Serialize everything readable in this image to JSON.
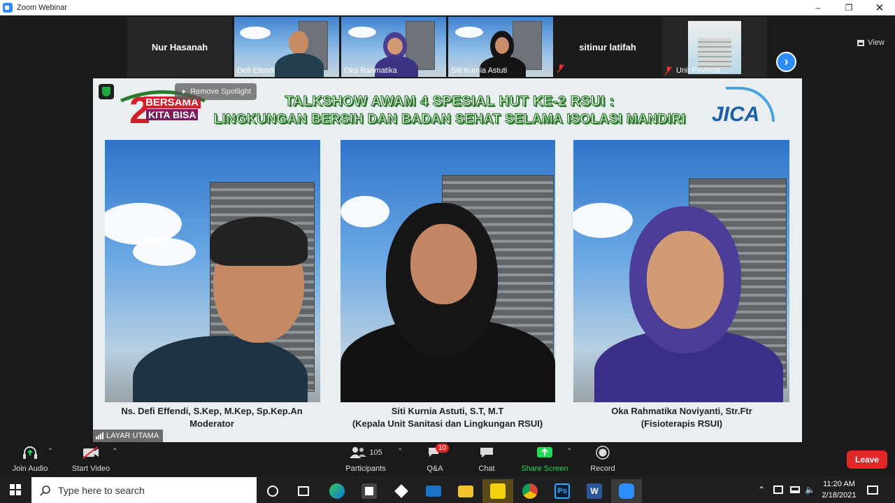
{
  "window": {
    "title": "Zoom Webinar"
  },
  "strip": {
    "tiles": [
      {
        "name": "Nur Hasanah",
        "type": "name-only"
      },
      {
        "name": "Defi Efendi",
        "type": "video"
      },
      {
        "name": "Oka Rahmatika",
        "type": "video"
      },
      {
        "name": "Siti Kurnia Astuti",
        "type": "video"
      },
      {
        "name": "sitinur latifah",
        "type": "name-only"
      },
      {
        "name": "Unit Promosi...",
        "type": "image"
      }
    ],
    "view_label": "View"
  },
  "stage": {
    "spotlight_label": "Remove Spotlight",
    "banner_line1": "TALKSHOW AWAM 4 SPESIAL HUT KE-2 RSUI :",
    "banner_line2": "LINGKUNGAN BERSIH DAN BADAN SEHAT SELAMA ISOLASI MANDIRI",
    "logo_left_lines": [
      "BERSAMA",
      "KITA BISA"
    ],
    "logo_right": "JICA",
    "panels": [
      {
        "name_line": "Ns. Defi Effendi, S.Kep, M.Kep, Sp.Kep.An",
        "role_line": "Moderator"
      },
      {
        "name_line": "Siti Kurnia Astuti, S.T, M.T",
        "role_line": "(Kepala Unit Sanitasi dan Lingkungan RSUI)"
      },
      {
        "name_line": "Oka Rahmatika Noviyanti, Str.Ftr",
        "role_line": "(Fisioterapis RSUI)"
      }
    ],
    "layar_label": "LAYAR UTAMA"
  },
  "toolbar": {
    "join_audio": "Join Audio",
    "start_video": "Start Video",
    "participants_label": "Participants",
    "participants_count": "105",
    "qa_label": "Q&A",
    "qa_badge": "10",
    "chat_label": "Chat",
    "share_label": "Share Screen",
    "record_label": "Record",
    "leave_label": "Leave"
  },
  "taskbar": {
    "search_placeholder": "Type here to search",
    "time": "11:20 AM",
    "date": "2/18/2021"
  },
  "colors": {
    "zoom_blue": "#2D8CFF",
    "leave_red": "#E02828",
    "share_green": "#23D959",
    "banner_green": "#2B7A2B"
  }
}
